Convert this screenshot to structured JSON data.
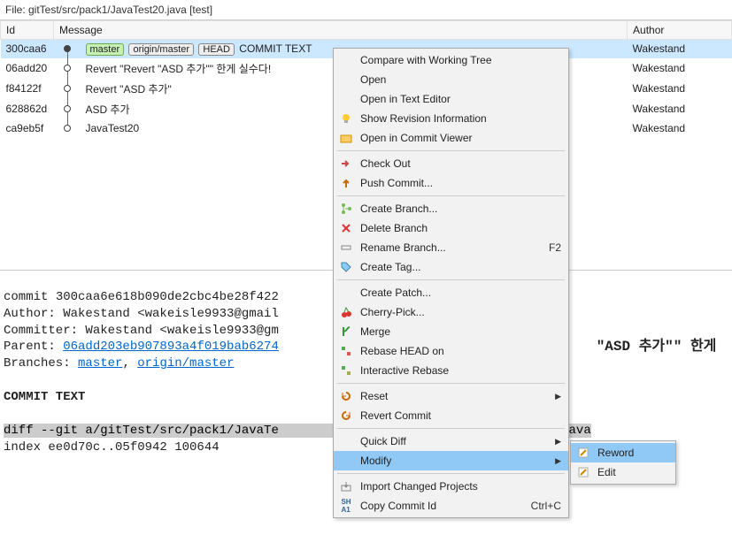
{
  "file_bar": {
    "label": "File: gitTest/src/pack1/JavaTest20.java [test]"
  },
  "columns": {
    "id": "Id",
    "message": "Message",
    "author": "Author"
  },
  "tags": {
    "master": "master",
    "origin_master": "origin/master",
    "head": "HEAD"
  },
  "rows": [
    {
      "id": "300caa6",
      "msg": "COMMIT TEXT",
      "author": "Wakestand",
      "selected": true,
      "head": true
    },
    {
      "id": "06add20",
      "msg": "Revert \"Revert \"ASD 추가\"\" 한게 실수다!",
      "author": "Wakestand"
    },
    {
      "id": "f84122f",
      "msg": "Revert \"ASD 추가\"",
      "author": "Wakestand"
    },
    {
      "id": "628862d",
      "msg": "ASD 추가",
      "author": "Wakestand"
    },
    {
      "id": "ca9eb5f",
      "msg": "JavaTest20",
      "author": "Wakestand"
    }
  ],
  "details": {
    "commit_label": "commit ",
    "commit": "300caa6e618b090de2cbc4be28f422",
    "author_label": "Author: ",
    "author_val": "Wakestand <wakeisle9933@gmail",
    "committer_label": "Committer: ",
    "committer_val": "Wakestand <wakeisle9933@gm",
    "parent_label": "Parent: ",
    "parent_link": "06add203eb907893a4f019bab6274",
    "branches_label": "Branches: ",
    "branch1": "master",
    "branch2": "origin/master",
    "revert_msg": "\"ASD 추가\"\" 한게 ",
    "commit_text": "COMMIT TEXT",
    "diff_line": "diff --git a/gitTest/src/pack1/JavaTe",
    "diff_tail": "0.java",
    "index_line": "index ee0d70c..05f0942 100644"
  },
  "menu": {
    "compare": "Compare with Working Tree",
    "open": "Open",
    "open_editor": "Open in Text Editor",
    "show_rev": "Show Revision Information",
    "open_commit_viewer": "Open in Commit Viewer",
    "checkout": "Check Out",
    "push": "Push Commit...",
    "create_branch": "Create Branch...",
    "delete_branch": "Delete Branch",
    "rename_branch": "Rename Branch...",
    "rename_accel": "F2",
    "create_tag": "Create Tag...",
    "create_patch": "Create Patch...",
    "cherry_pick": "Cherry-Pick...",
    "merge": "Merge",
    "rebase_head": "Rebase HEAD on",
    "interactive_rebase": "Interactive Rebase",
    "reset": "Reset",
    "revert": "Revert Commit",
    "quick_diff": "Quick Diff",
    "modify": "Modify",
    "import_proj": "Import Changed Projects",
    "copy_id": "Copy Commit Id",
    "copy_accel": "Ctrl+C"
  },
  "submenu": {
    "reword": "Reword",
    "edit": "Edit"
  }
}
